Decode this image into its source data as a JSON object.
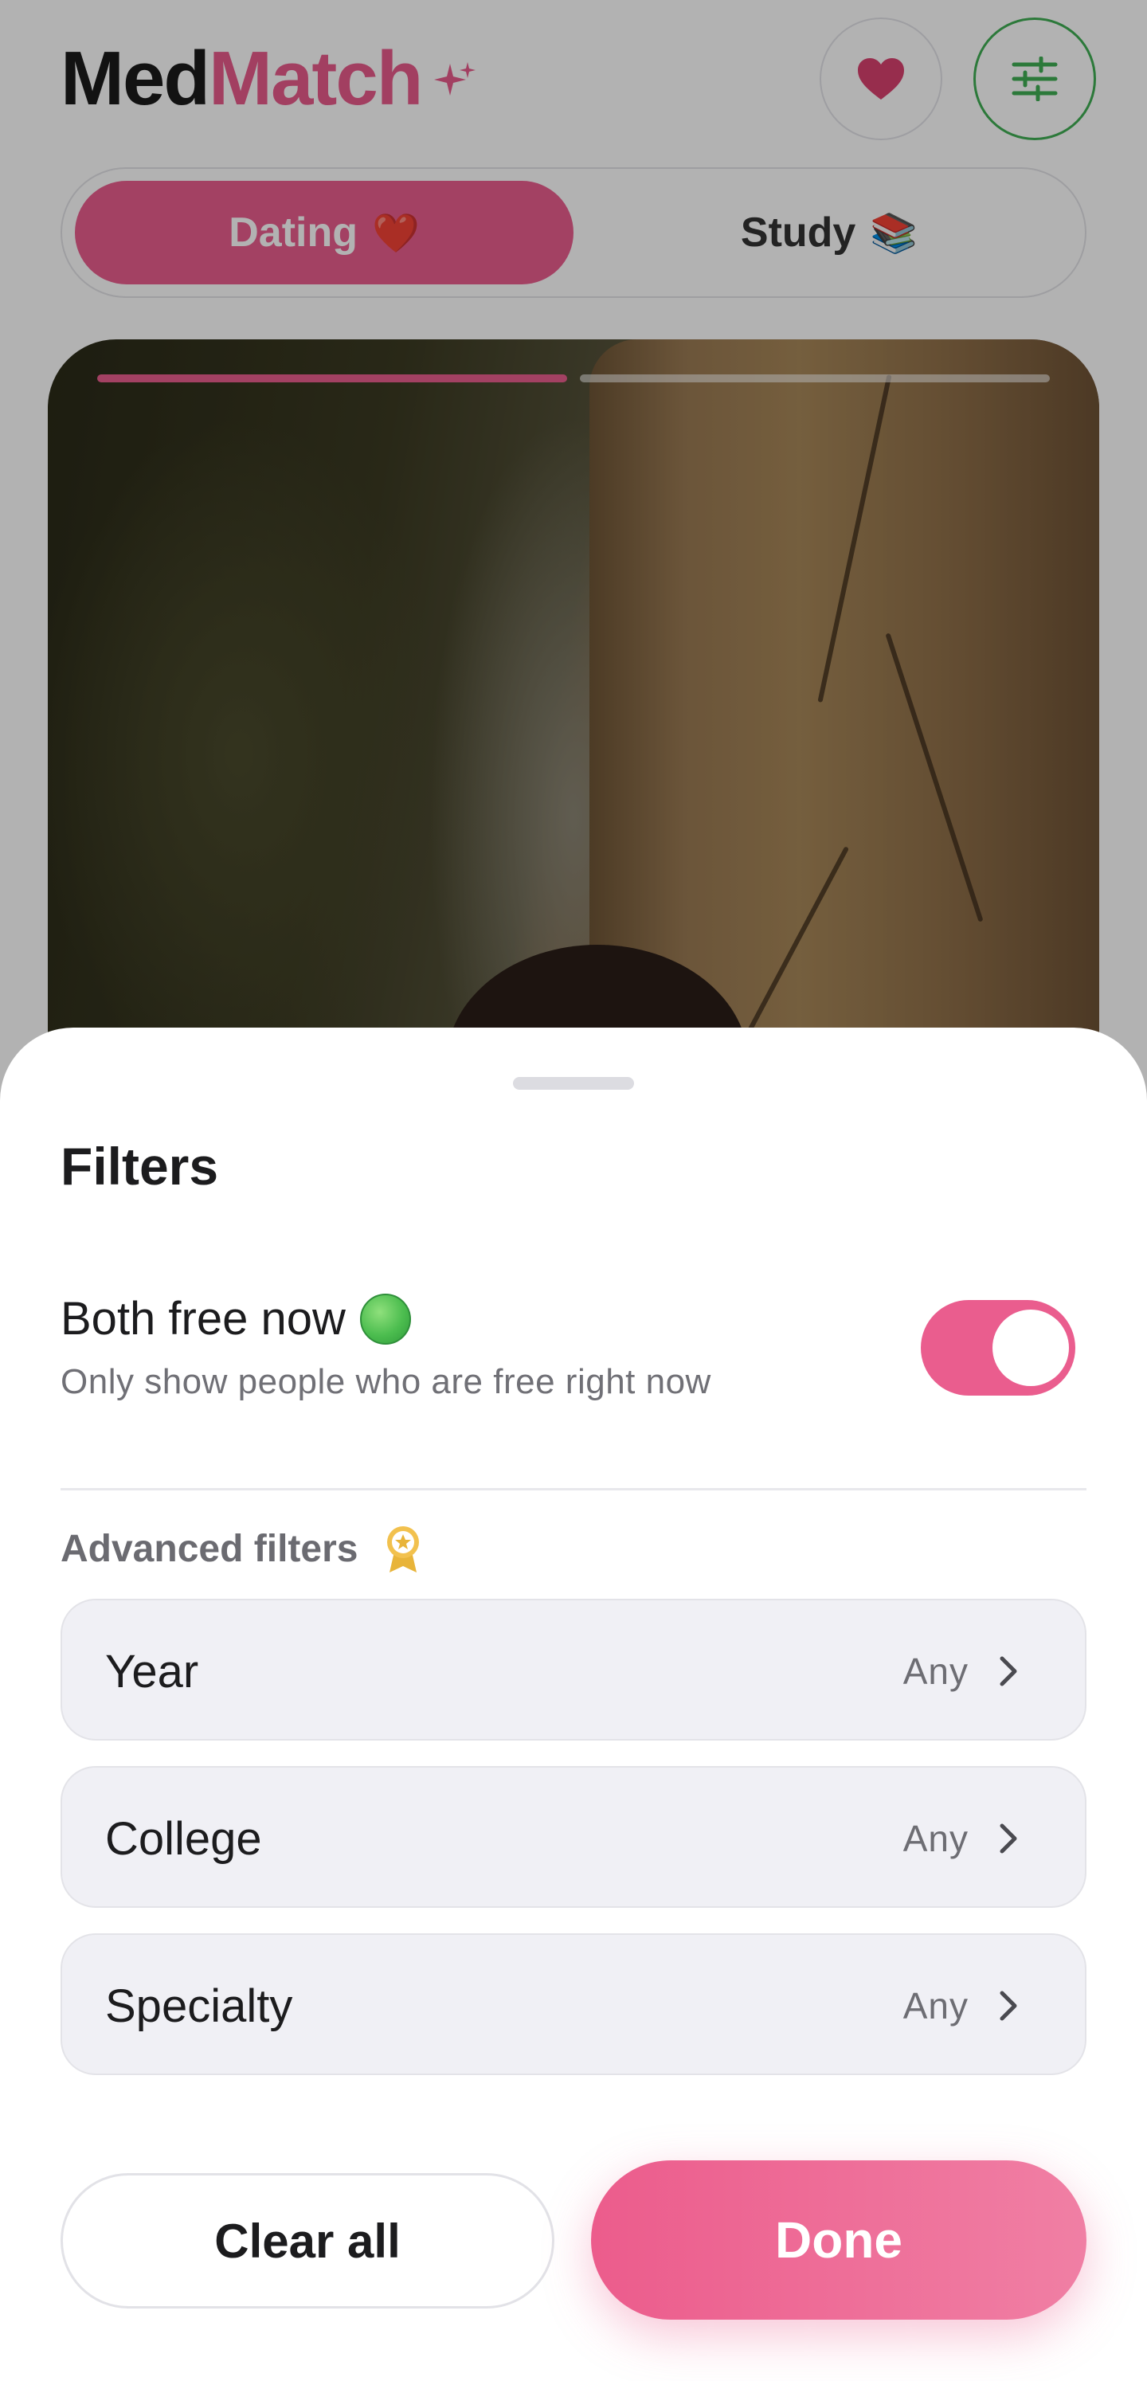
{
  "app": {
    "brand_part1": "Med",
    "brand_part2": "Match",
    "brand_icon": "sparkle-icon",
    "header_buttons": {
      "likes_icon": "heart-icon",
      "filter_icon": "sliders-icon"
    },
    "mode_tabs": [
      {
        "label": "Dating",
        "emoji": "❤️",
        "active": true
      },
      {
        "label": "Study",
        "emoji": "📚",
        "active": false
      }
    ],
    "photo_progress": {
      "current": 1,
      "total": 2
    }
  },
  "sheet": {
    "title": "Filters",
    "free_now": {
      "title": "Both free now",
      "subtitle": "Only show people who are free right now",
      "indicator_icon": "green-circle-icon",
      "enabled": true
    },
    "advanced_label": "Advanced filters",
    "advanced_icon": "premium-badge-icon",
    "rows": [
      {
        "label": "Year",
        "value": "Any"
      },
      {
        "label": "College",
        "value": "Any"
      },
      {
        "label": "Specialty",
        "value": "Any"
      }
    ],
    "clear_label": "Clear all",
    "done_label": "Done"
  },
  "colors": {
    "accent_pink": "#ea5d8e",
    "filter_ring_green": "#3fae54",
    "text_dark": "#1c1c1e",
    "text_muted": "#707076",
    "row_bg": "#f0f0f5"
  }
}
